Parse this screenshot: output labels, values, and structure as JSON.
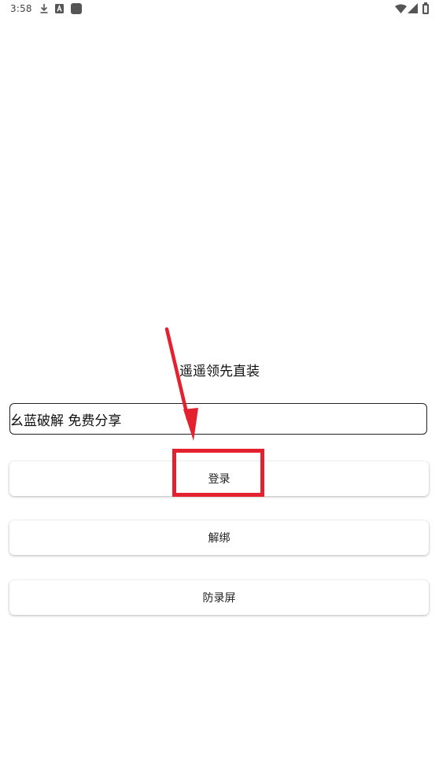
{
  "status_bar": {
    "time": "3:58",
    "left_icons": [
      "download-icon",
      "a-badge-icon",
      "square-notification-icon"
    ],
    "right_icons": [
      "wifi-icon",
      "signal-icon",
      "battery-icon"
    ]
  },
  "app": {
    "title": "遥遥领先直装",
    "key_field_value": "幺蓝破解 免费分享"
  },
  "buttons": {
    "login": "登录",
    "unbind": "解绑",
    "anti_record": "防录屏"
  },
  "annotation": {
    "color": "#e3212f",
    "arrow_target": "login-button"
  }
}
